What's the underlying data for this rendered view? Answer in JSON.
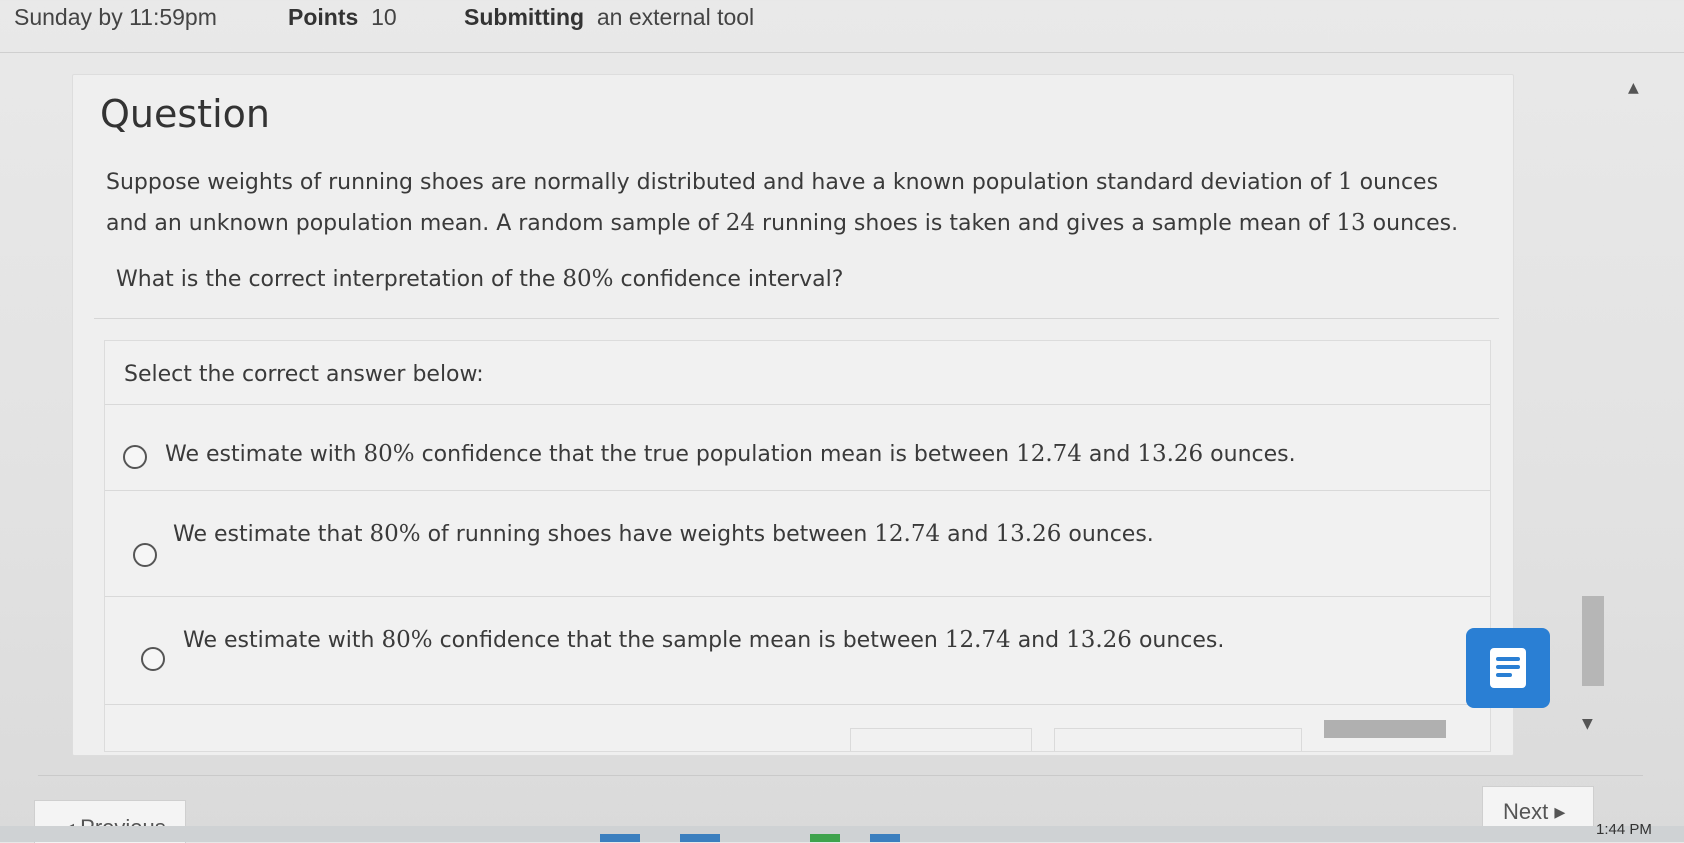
{
  "header": {
    "due_label": "Sunday by 11:59pm",
    "points_label": "Points",
    "points_value": "10",
    "submitting_label": "Submitting",
    "submitting_value": "an external tool"
  },
  "question": {
    "title": "Question",
    "text_line1_a": "Suppose weights of running shoes are normally distributed and have a known population standard deviation of ",
    "sd": "1",
    "text_line1_b": " ounces",
    "text_line2_a": "and an unknown population mean. A random sample of ",
    "n": "24",
    "text_line2_b": " running shoes is taken and gives a sample mean of ",
    "mean": "13",
    "text_line2_c": " ounces.",
    "prompt_a": "What is the correct interpretation of the ",
    "prompt_pct": "80%",
    "prompt_b": " confidence interval?"
  },
  "answers": {
    "label": "Select the correct answer below:",
    "options": [
      {
        "a": "We estimate with ",
        "pct": "80%",
        "b": " confidence that the true population mean is between ",
        "lo": "12.74",
        "mid": " and ",
        "hi": "13.26",
        "c": " ounces."
      },
      {
        "a": "We estimate that ",
        "pct": "80%",
        "b": " of running shoes have weights between ",
        "lo": "12.74",
        "mid": " and ",
        "hi": "13.26",
        "c": " ounces."
      },
      {
        "a": "We estimate with ",
        "pct": "80%",
        "b": " confidence that the sample mean is between ",
        "lo": "12.74",
        "mid": " and ",
        "hi": "13.26",
        "c": " ounces."
      }
    ]
  },
  "nav": {
    "previous": "◂ Previous",
    "next": "Next ▸"
  },
  "taskbar": {
    "clock": "1:44 PM"
  },
  "colors": {
    "accent": "#2a7fd4"
  }
}
